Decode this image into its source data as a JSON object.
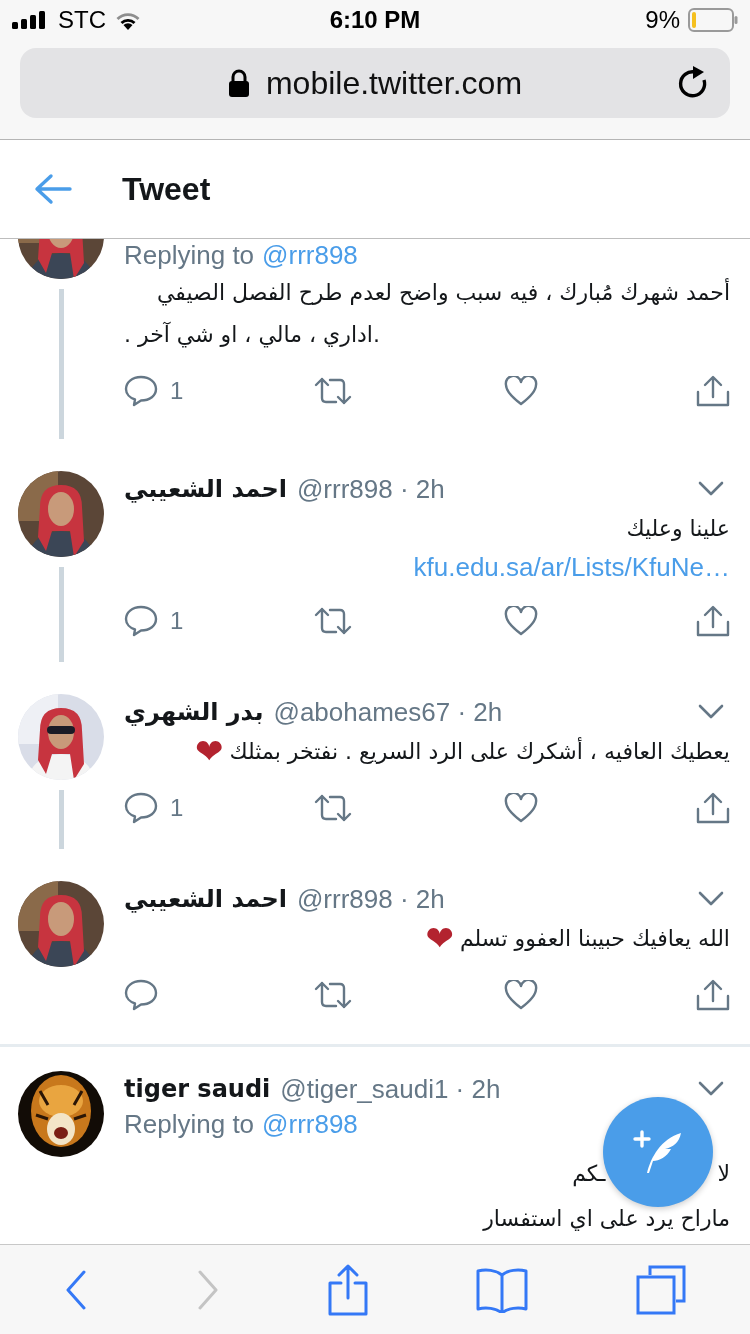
{
  "status_bar": {
    "carrier": "STC",
    "time": "6:10 PM",
    "battery": "9%"
  },
  "browser": {
    "url": "mobile.twitter.com"
  },
  "header": {
    "title": "Tweet"
  },
  "tweets": [
    {
      "kind": "cut_top",
      "replying_label": "Replying to",
      "replying_handle": "@rrr898",
      "thread_line": true,
      "lines": [
        {
          "text": "أحمد شهرك مُبارك ، فيه سبب واضح لعدم طرح الفصل الصيفي"
        },
        {
          "text": ". اداري ، مالي ، او شي آخر.",
          "ltr": true
        }
      ],
      "actions": true,
      "reply_count": "1"
    },
    {
      "kind": "full",
      "name": "احمد الشعيبي",
      "meta": "@rrr898 · 2h",
      "thread_line": true,
      "lines": [
        {
          "text": "علينا وعليك"
        }
      ],
      "link": "kfu.edu.sa/ar/Lists/KfuNe…",
      "actions": true,
      "reply_count": "1"
    },
    {
      "kind": "full",
      "name": "بدر الشهري",
      "meta": "@abohames67 · 2h",
      "thread_line": true,
      "lines": [
        {
          "text": "يعطيك العافيه ، أشكرك على الرد السريع .      نفتخر بمثلك",
          "emoji": "❤"
        }
      ],
      "actions": true,
      "reply_count": "1"
    },
    {
      "kind": "full",
      "name": "احمد الشعيبي",
      "meta": "@rrr898 · 2h",
      "thread_line": false,
      "lines": [
        {
          "text": "الله يعافيك حبيبنا العفوو تسلم",
          "emoji": "❤"
        }
      ],
      "actions": true
    },
    {
      "kind": "cut_bottom",
      "name": "tiger saudi",
      "meta": "@tiger_saudi1 · 2h",
      "thread_line": false,
      "replying_label": "Replying to",
      "replying_handle": "@rrr898",
      "covered_line": [
        "لا",
        "ـكم"
      ],
      "lines": [
        {
          "text": "ماراح يرد على اي استفسار"
        }
      ],
      "actions": false
    }
  ],
  "toolbar": [
    {
      "kind": "back",
      "disabled": false
    },
    {
      "kind": "forward",
      "disabled": true
    },
    {
      "kind": "share",
      "disabled": false
    },
    {
      "kind": "bookmarks",
      "disabled": false
    },
    {
      "kind": "tabs",
      "disabled": false
    }
  ]
}
